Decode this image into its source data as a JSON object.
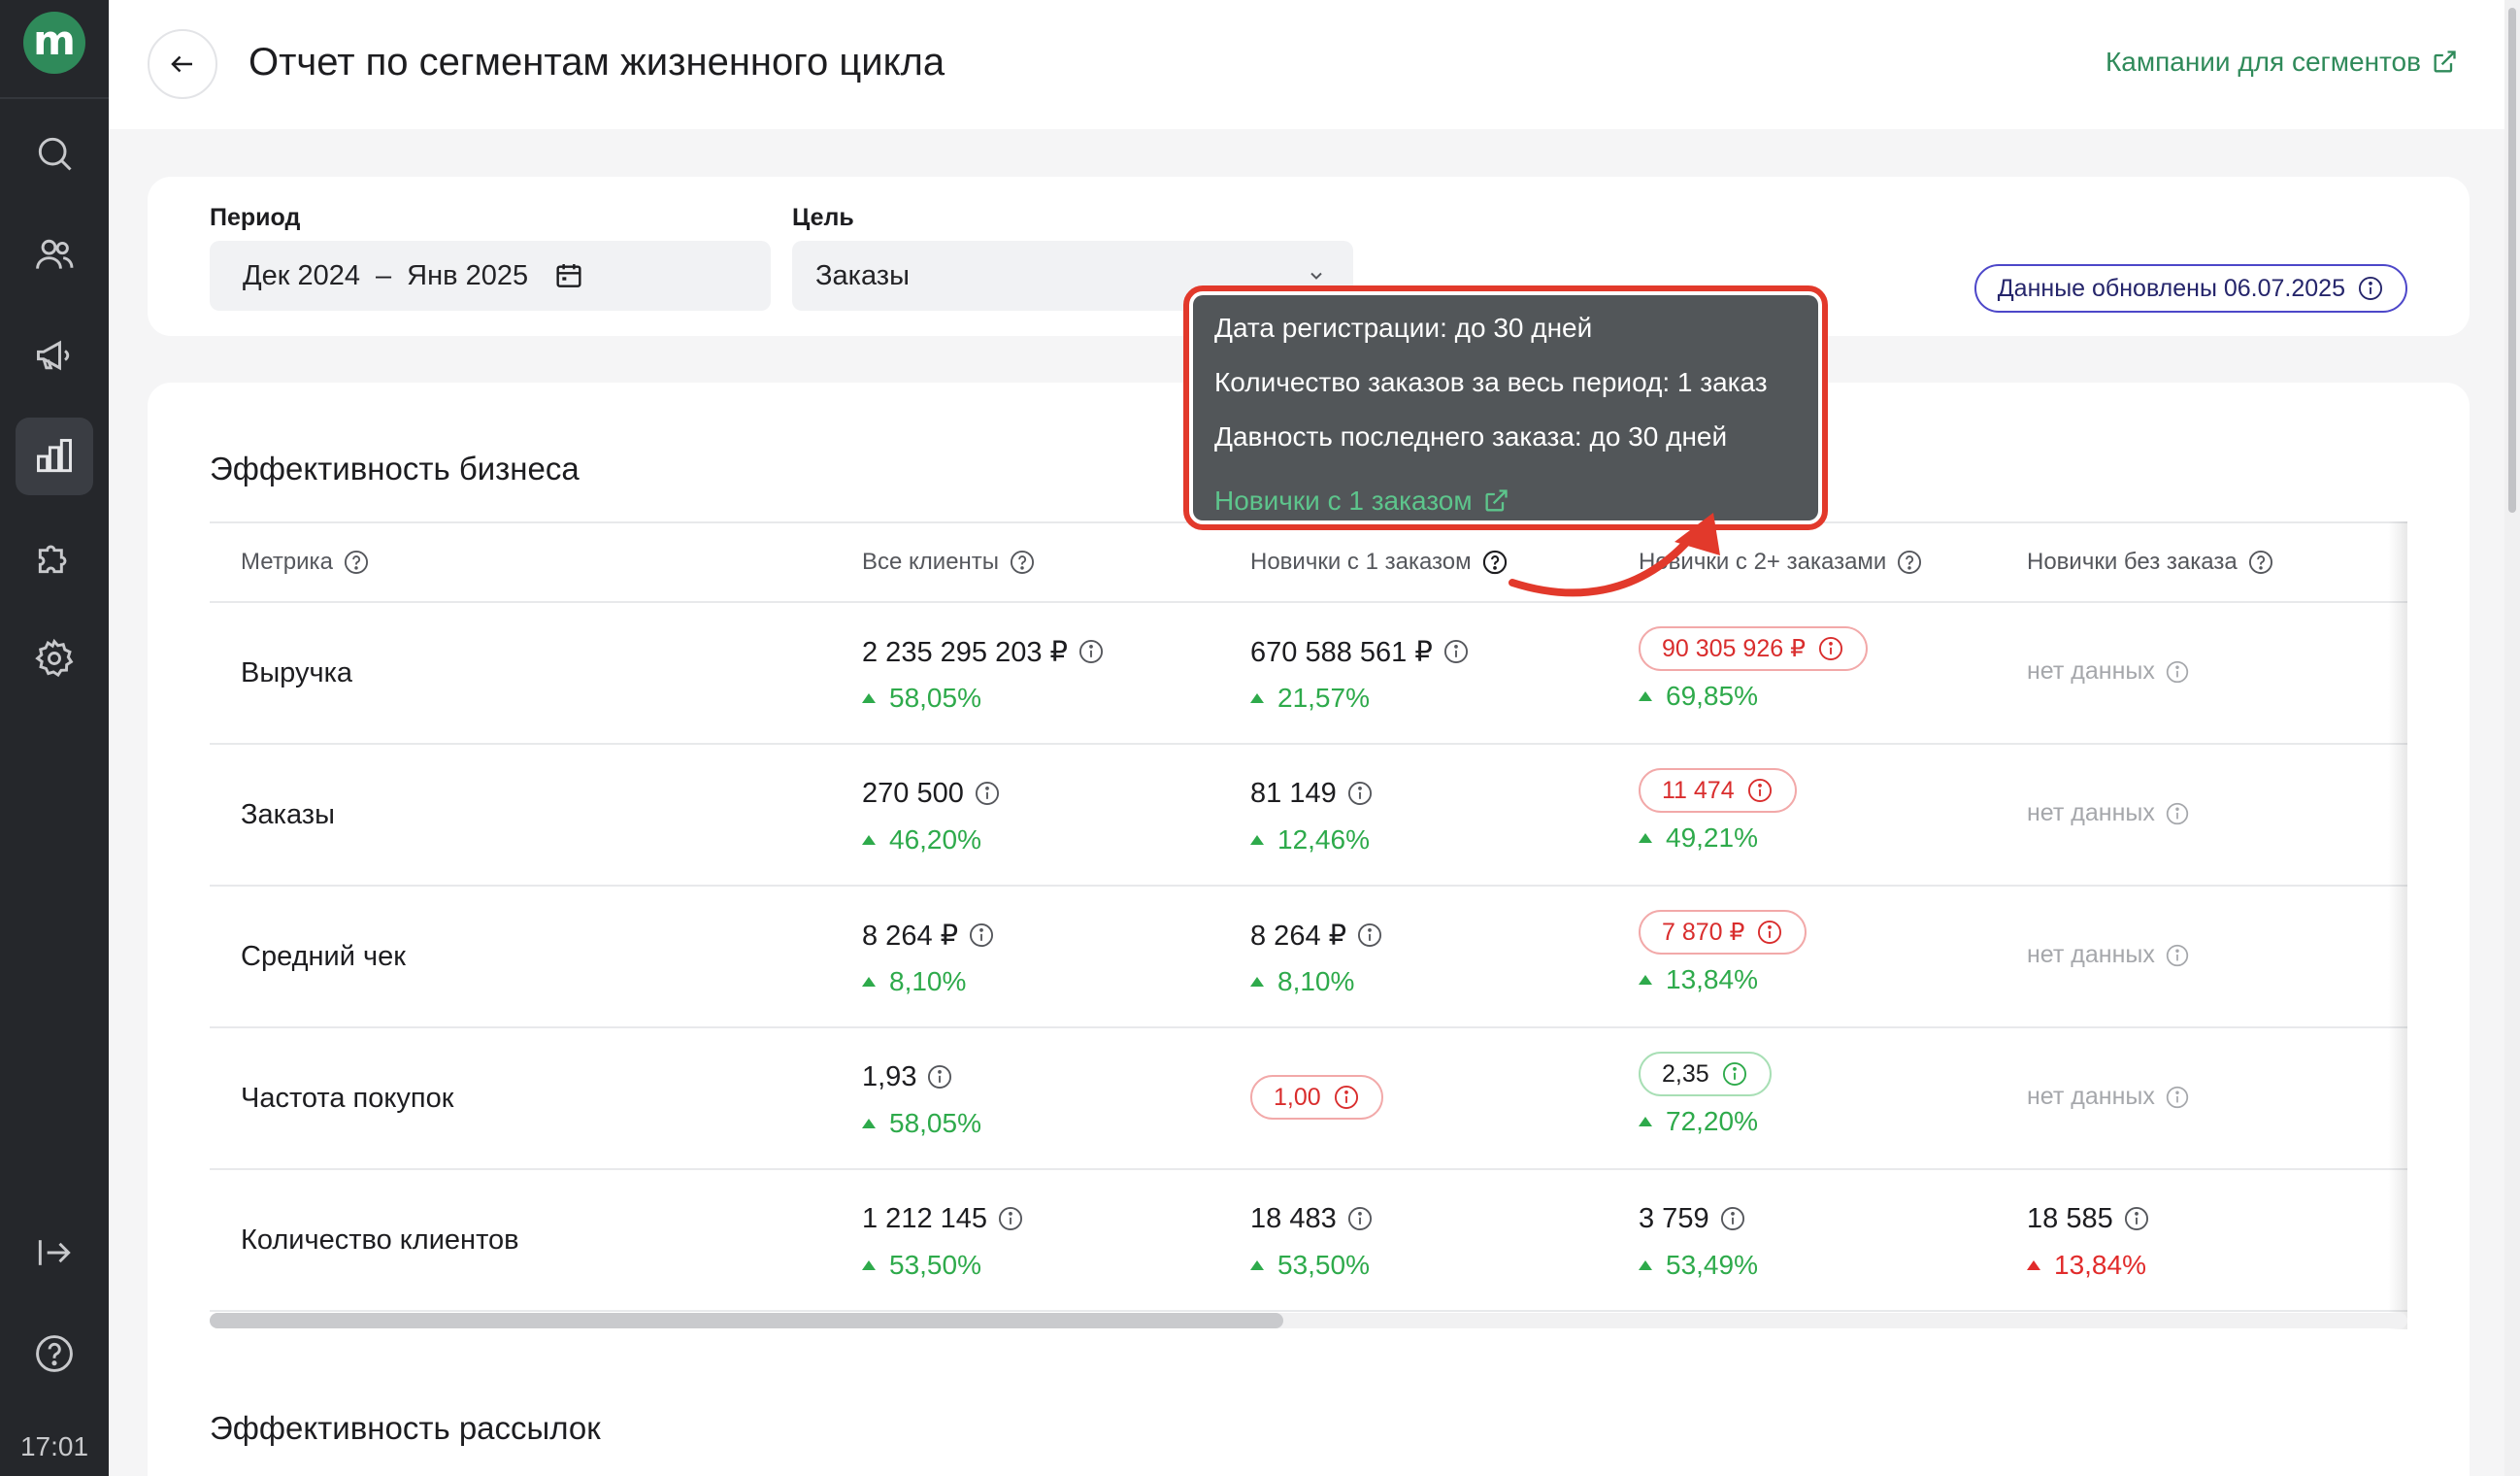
{
  "app": {
    "logo_letter": "m",
    "time": "17:01",
    "accent_color": "#2f8a5a"
  },
  "sidebar": {
    "items": [
      {
        "icon": "search-icon"
      },
      {
        "icon": "users-icon"
      },
      {
        "icon": "megaphone-icon"
      },
      {
        "icon": "analytics-icon",
        "active": true
      },
      {
        "icon": "puzzle-icon"
      },
      {
        "icon": "settings-icon"
      }
    ],
    "bottom": [
      {
        "icon": "logout-icon"
      },
      {
        "icon": "help-icon"
      }
    ]
  },
  "header": {
    "title": "Отчет по сегментам жизненного цикла",
    "campaign_link": "Кампании для сегментов"
  },
  "filters": {
    "period_label": "Период",
    "period_from": "Дек 2024",
    "period_sep": "–",
    "period_to": "Янв 2025",
    "goal_label": "Цель",
    "goal_value": "Заказы",
    "updated_badge": "Данные обновлены 06.07.2025"
  },
  "business": {
    "title": "Эффективность бизнеса",
    "columns": [
      "Метрика",
      "Все клиенты",
      "Новички с 1 заказом",
      "Новички с 2+ заказами",
      "Новички без заказа"
    ],
    "no_data": "нет данных",
    "rows": [
      {
        "metric": "Выручка",
        "all": {
          "value": "2 235 295 203 ₽",
          "delta": "58,05%"
        },
        "one": {
          "value": "670 588 561 ₽",
          "delta": "21,57%"
        },
        "two": {
          "value": "90 305 926 ₽",
          "delta": "69,85%"
        }
      },
      {
        "metric": "Заказы",
        "all": {
          "value": "270 500",
          "delta": "46,20%"
        },
        "one": {
          "value": "81 149",
          "delta": "12,46%"
        },
        "two": {
          "value": "11 474",
          "delta": "49,21%"
        }
      },
      {
        "metric": "Средний чек",
        "all": {
          "value": "8 264 ₽",
          "delta": "8,10%"
        },
        "one": {
          "value": "8 264 ₽",
          "delta": "8,10%"
        },
        "two": {
          "value": "7 870 ₽",
          "delta": "13,84%"
        }
      },
      {
        "metric": "Частота покупок",
        "all": {
          "value": "1,93",
          "delta": "58,05%"
        },
        "one": {
          "value": "1,00"
        },
        "two": {
          "value": "2,35",
          "delta": "72,20%"
        }
      },
      {
        "metric": "Количество клиентов",
        "all": {
          "value": "1 212 145",
          "delta": "53,50%"
        },
        "one": {
          "value": "18 483",
          "delta": "53,50%"
        },
        "two": {
          "value": "3 759",
          "delta": "53,49%"
        },
        "none": {
          "value": "18 585",
          "delta": "13,84%"
        }
      }
    ]
  },
  "mailings": {
    "title": "Эффективность рассылок"
  },
  "tooltip": {
    "line1": "Дата регистрации: до 30 дней",
    "line2": "Количество заказов за весь период: 1 заказ",
    "line3": "Давность последнего заказа: до 30 дней",
    "link": "Новички с 1 заказом"
  }
}
